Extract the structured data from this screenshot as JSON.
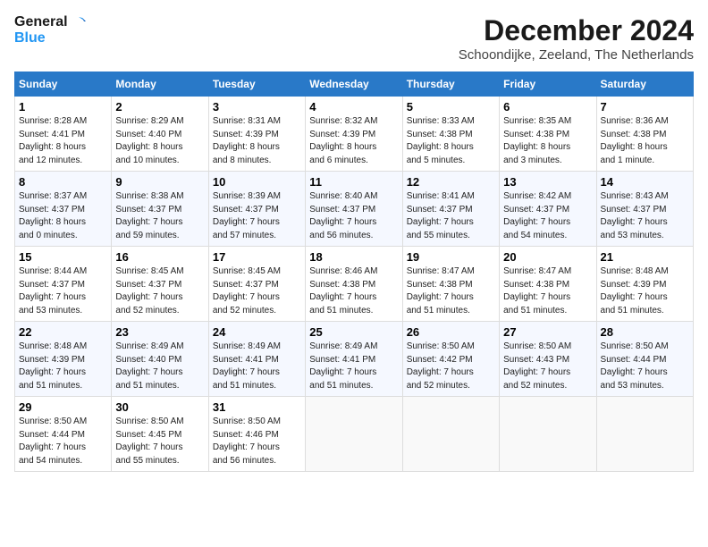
{
  "header": {
    "logo_line1": "General",
    "logo_line2": "Blue",
    "title": "December 2024",
    "subtitle": "Schoondijke, Zeeland, The Netherlands"
  },
  "columns": [
    "Sunday",
    "Monday",
    "Tuesday",
    "Wednesday",
    "Thursday",
    "Friday",
    "Saturday"
  ],
  "weeks": [
    [
      {
        "day": "1",
        "info": "Sunrise: 8:28 AM\nSunset: 4:41 PM\nDaylight: 8 hours\nand 12 minutes."
      },
      {
        "day": "2",
        "info": "Sunrise: 8:29 AM\nSunset: 4:40 PM\nDaylight: 8 hours\nand 10 minutes."
      },
      {
        "day": "3",
        "info": "Sunrise: 8:31 AM\nSunset: 4:39 PM\nDaylight: 8 hours\nand 8 minutes."
      },
      {
        "day": "4",
        "info": "Sunrise: 8:32 AM\nSunset: 4:39 PM\nDaylight: 8 hours\nand 6 minutes."
      },
      {
        "day": "5",
        "info": "Sunrise: 8:33 AM\nSunset: 4:38 PM\nDaylight: 8 hours\nand 5 minutes."
      },
      {
        "day": "6",
        "info": "Sunrise: 8:35 AM\nSunset: 4:38 PM\nDaylight: 8 hours\nand 3 minutes."
      },
      {
        "day": "7",
        "info": "Sunrise: 8:36 AM\nSunset: 4:38 PM\nDaylight: 8 hours\nand 1 minute."
      }
    ],
    [
      {
        "day": "8",
        "info": "Sunrise: 8:37 AM\nSunset: 4:37 PM\nDaylight: 8 hours\nand 0 minutes."
      },
      {
        "day": "9",
        "info": "Sunrise: 8:38 AM\nSunset: 4:37 PM\nDaylight: 7 hours\nand 59 minutes."
      },
      {
        "day": "10",
        "info": "Sunrise: 8:39 AM\nSunset: 4:37 PM\nDaylight: 7 hours\nand 57 minutes."
      },
      {
        "day": "11",
        "info": "Sunrise: 8:40 AM\nSunset: 4:37 PM\nDaylight: 7 hours\nand 56 minutes."
      },
      {
        "day": "12",
        "info": "Sunrise: 8:41 AM\nSunset: 4:37 PM\nDaylight: 7 hours\nand 55 minutes."
      },
      {
        "day": "13",
        "info": "Sunrise: 8:42 AM\nSunset: 4:37 PM\nDaylight: 7 hours\nand 54 minutes."
      },
      {
        "day": "14",
        "info": "Sunrise: 8:43 AM\nSunset: 4:37 PM\nDaylight: 7 hours\nand 53 minutes."
      }
    ],
    [
      {
        "day": "15",
        "info": "Sunrise: 8:44 AM\nSunset: 4:37 PM\nDaylight: 7 hours\nand 53 minutes."
      },
      {
        "day": "16",
        "info": "Sunrise: 8:45 AM\nSunset: 4:37 PM\nDaylight: 7 hours\nand 52 minutes."
      },
      {
        "day": "17",
        "info": "Sunrise: 8:45 AM\nSunset: 4:37 PM\nDaylight: 7 hours\nand 52 minutes."
      },
      {
        "day": "18",
        "info": "Sunrise: 8:46 AM\nSunset: 4:38 PM\nDaylight: 7 hours\nand 51 minutes."
      },
      {
        "day": "19",
        "info": "Sunrise: 8:47 AM\nSunset: 4:38 PM\nDaylight: 7 hours\nand 51 minutes."
      },
      {
        "day": "20",
        "info": "Sunrise: 8:47 AM\nSunset: 4:38 PM\nDaylight: 7 hours\nand 51 minutes."
      },
      {
        "day": "21",
        "info": "Sunrise: 8:48 AM\nSunset: 4:39 PM\nDaylight: 7 hours\nand 51 minutes."
      }
    ],
    [
      {
        "day": "22",
        "info": "Sunrise: 8:48 AM\nSunset: 4:39 PM\nDaylight: 7 hours\nand 51 minutes."
      },
      {
        "day": "23",
        "info": "Sunrise: 8:49 AM\nSunset: 4:40 PM\nDaylight: 7 hours\nand 51 minutes."
      },
      {
        "day": "24",
        "info": "Sunrise: 8:49 AM\nSunset: 4:41 PM\nDaylight: 7 hours\nand 51 minutes."
      },
      {
        "day": "25",
        "info": "Sunrise: 8:49 AM\nSunset: 4:41 PM\nDaylight: 7 hours\nand 51 minutes."
      },
      {
        "day": "26",
        "info": "Sunrise: 8:50 AM\nSunset: 4:42 PM\nDaylight: 7 hours\nand 52 minutes."
      },
      {
        "day": "27",
        "info": "Sunrise: 8:50 AM\nSunset: 4:43 PM\nDaylight: 7 hours\nand 52 minutes."
      },
      {
        "day": "28",
        "info": "Sunrise: 8:50 AM\nSunset: 4:44 PM\nDaylight: 7 hours\nand 53 minutes."
      }
    ],
    [
      {
        "day": "29",
        "info": "Sunrise: 8:50 AM\nSunset: 4:44 PM\nDaylight: 7 hours\nand 54 minutes."
      },
      {
        "day": "30",
        "info": "Sunrise: 8:50 AM\nSunset: 4:45 PM\nDaylight: 7 hours\nand 55 minutes."
      },
      {
        "day": "31",
        "info": "Sunrise: 8:50 AM\nSunset: 4:46 PM\nDaylight: 7 hours\nand 56 minutes."
      },
      null,
      null,
      null,
      null
    ]
  ]
}
